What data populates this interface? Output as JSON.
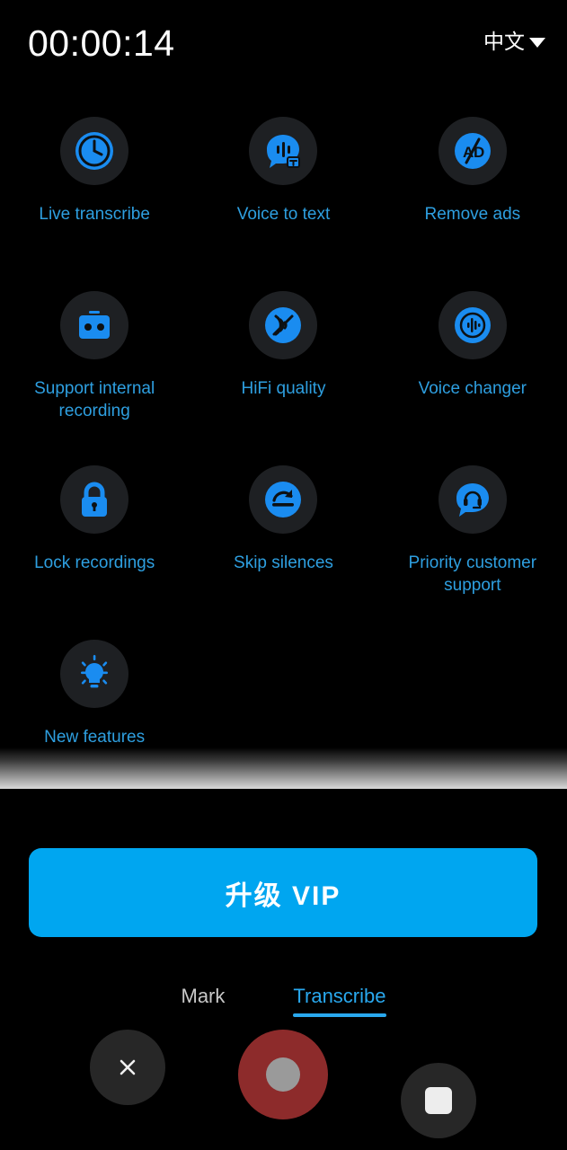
{
  "header": {
    "timer": "00:00:14",
    "language": "中文",
    "caret_icon": "chevron-down-icon"
  },
  "features": [
    {
      "id": "live-transcribe",
      "label": "Live transcribe",
      "icon": "clock-icon"
    },
    {
      "id": "voice-to-text",
      "label": "Voice to text",
      "icon": "speech-waveform-text-icon"
    },
    {
      "id": "remove-ads",
      "label": "Remove ads",
      "icon": "no-ads-icon"
    },
    {
      "id": "internal-recording",
      "label": "Support internal recording",
      "icon": "cassette-tape-icon"
    },
    {
      "id": "hifi-quality",
      "label": "HiFi quality",
      "icon": "hifi-wave-icon"
    },
    {
      "id": "voice-changer",
      "label": "Voice changer",
      "icon": "voice-changer-icon"
    },
    {
      "id": "lock-recordings",
      "label": "Lock recordings",
      "icon": "lock-icon"
    },
    {
      "id": "skip-silences",
      "label": "Skip silences",
      "icon": "skip-forward-arc-icon"
    },
    {
      "id": "priority-support",
      "label": "Priority customer support",
      "icon": "headset-bubble-icon"
    },
    {
      "id": "new-features",
      "label": "New features",
      "icon": "lightbulb-icon"
    }
  ],
  "vip": {
    "label": "升级 VIP"
  },
  "tabs": [
    {
      "id": "mark",
      "label": "Mark",
      "active": false
    },
    {
      "id": "transcribe",
      "label": "Transcribe",
      "active": true
    }
  ],
  "controls": {
    "cancel_icon": "close-icon",
    "record_icon": "record-dot-icon",
    "stop_icon": "stop-square-icon"
  },
  "colors": {
    "background": "#000000",
    "accent_blue": "#2e9fe0",
    "vip_blue": "#00a6f0",
    "tab_active": "#29a8ee",
    "tab_inactive": "#c8c8c8",
    "icon_bubble": "#1e2023",
    "icon_blue": "#1a8cf0",
    "record_red": "#8d2b2b",
    "control_gray": "#272727"
  }
}
